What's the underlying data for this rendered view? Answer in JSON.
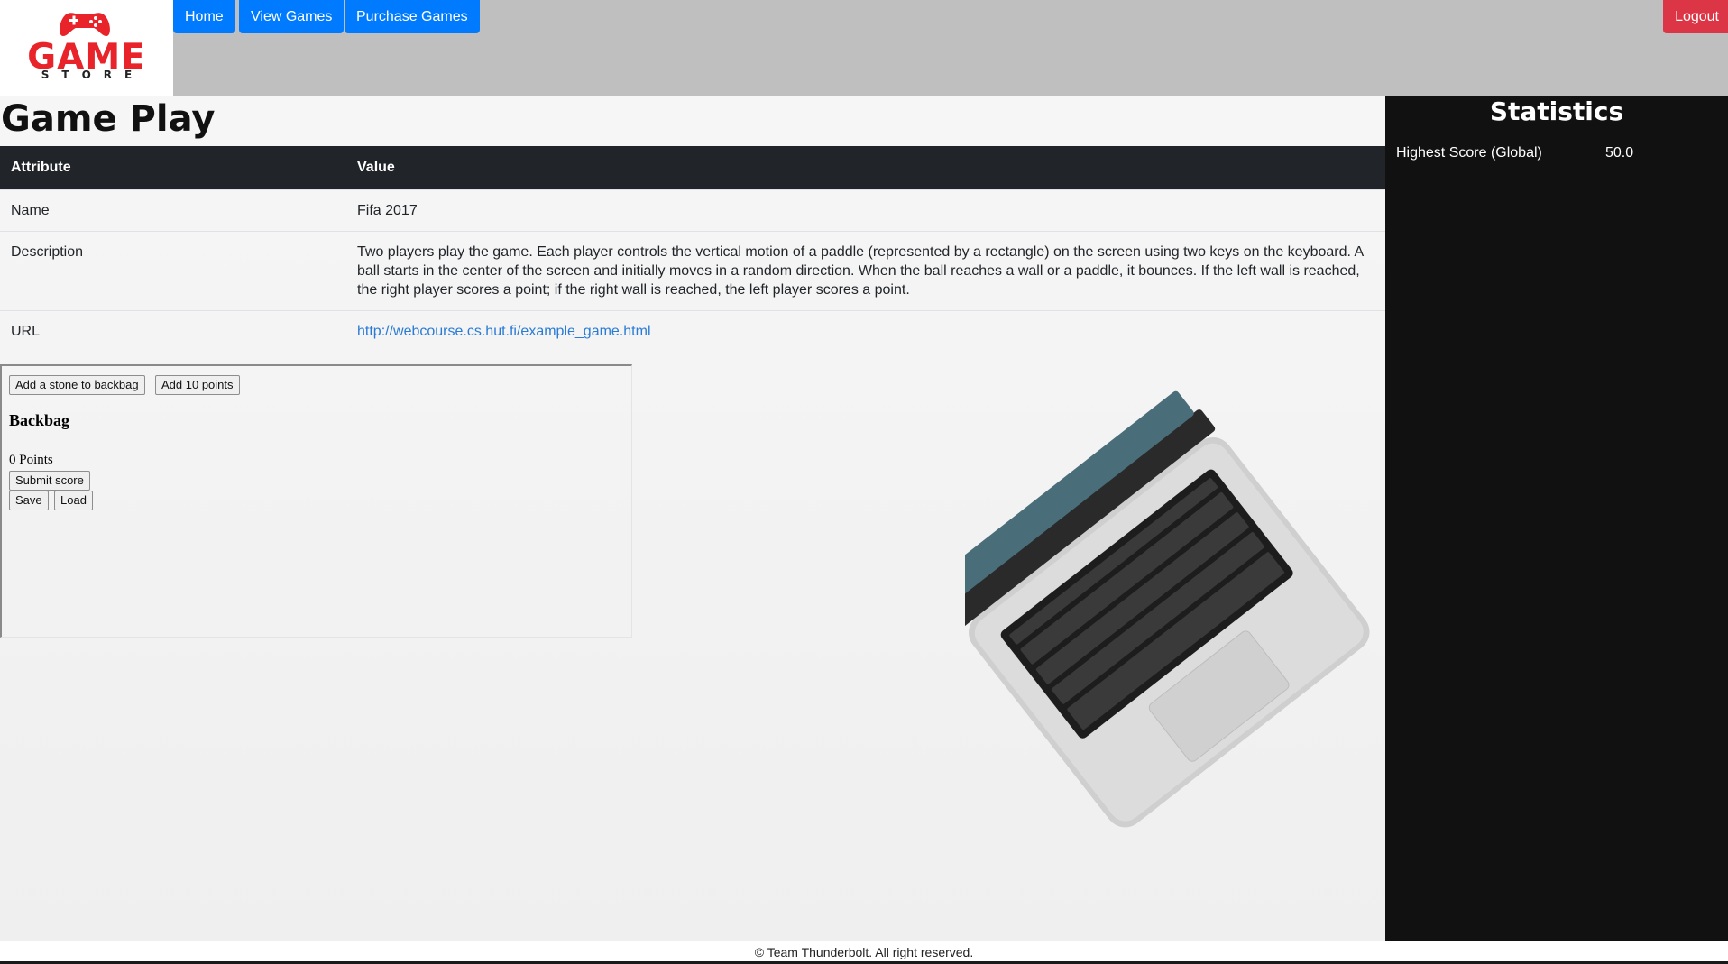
{
  "header": {
    "logo": {
      "title": "GAME",
      "subtitle": "STORE"
    },
    "nav": [
      {
        "label": "Home"
      },
      {
        "label": "View Games"
      },
      {
        "label": "Purchase Games"
      }
    ],
    "logout_label": "Logout"
  },
  "main": {
    "title": "Game Play",
    "table": {
      "headers": [
        "Attribute",
        "Value"
      ],
      "rows": [
        {
          "attribute": "Name",
          "value": "Fifa 2017"
        },
        {
          "attribute": "Description",
          "value": "Two players play the game. Each player controls the vertical motion of a paddle (represented by a rectangle) on the screen using two keys on the keyboard. A ball starts in the center of the screen and initially moves in a random direction. When the ball reaches a wall or a paddle, it bounces. If the left wall is reached, the right player scores a point; if the right wall is reached, the left player scores a point."
        },
        {
          "attribute": "URL",
          "value": "http://webcourse.cs.hut.fi/example_game.html"
        }
      ]
    },
    "game": {
      "add_stone_label": "Add a stone to backbag",
      "add_points_label": "Add 10 points",
      "backbag_title": "Backbag",
      "points_text": "0 Points",
      "submit_label": "Submit score",
      "save_label": "Save",
      "load_label": "Load"
    }
  },
  "sidebar": {
    "title": "Statistics",
    "stats": [
      {
        "label": "Highest Score (Global)",
        "value": "50.0"
      }
    ]
  },
  "footer": {
    "text": "© Team Thunderbolt. All right reserved."
  },
  "colors": {
    "nav_button": "#007bff",
    "logout_button": "#dc3545",
    "header_bg": "#bfbfbf",
    "sidebar_bg": "#111111",
    "table_header_bg": "#212529",
    "link": "#2a7bd5",
    "logo_red": "#e8232a"
  },
  "icons": {
    "logo": "gamepad-icon",
    "background": "laptop-image"
  }
}
